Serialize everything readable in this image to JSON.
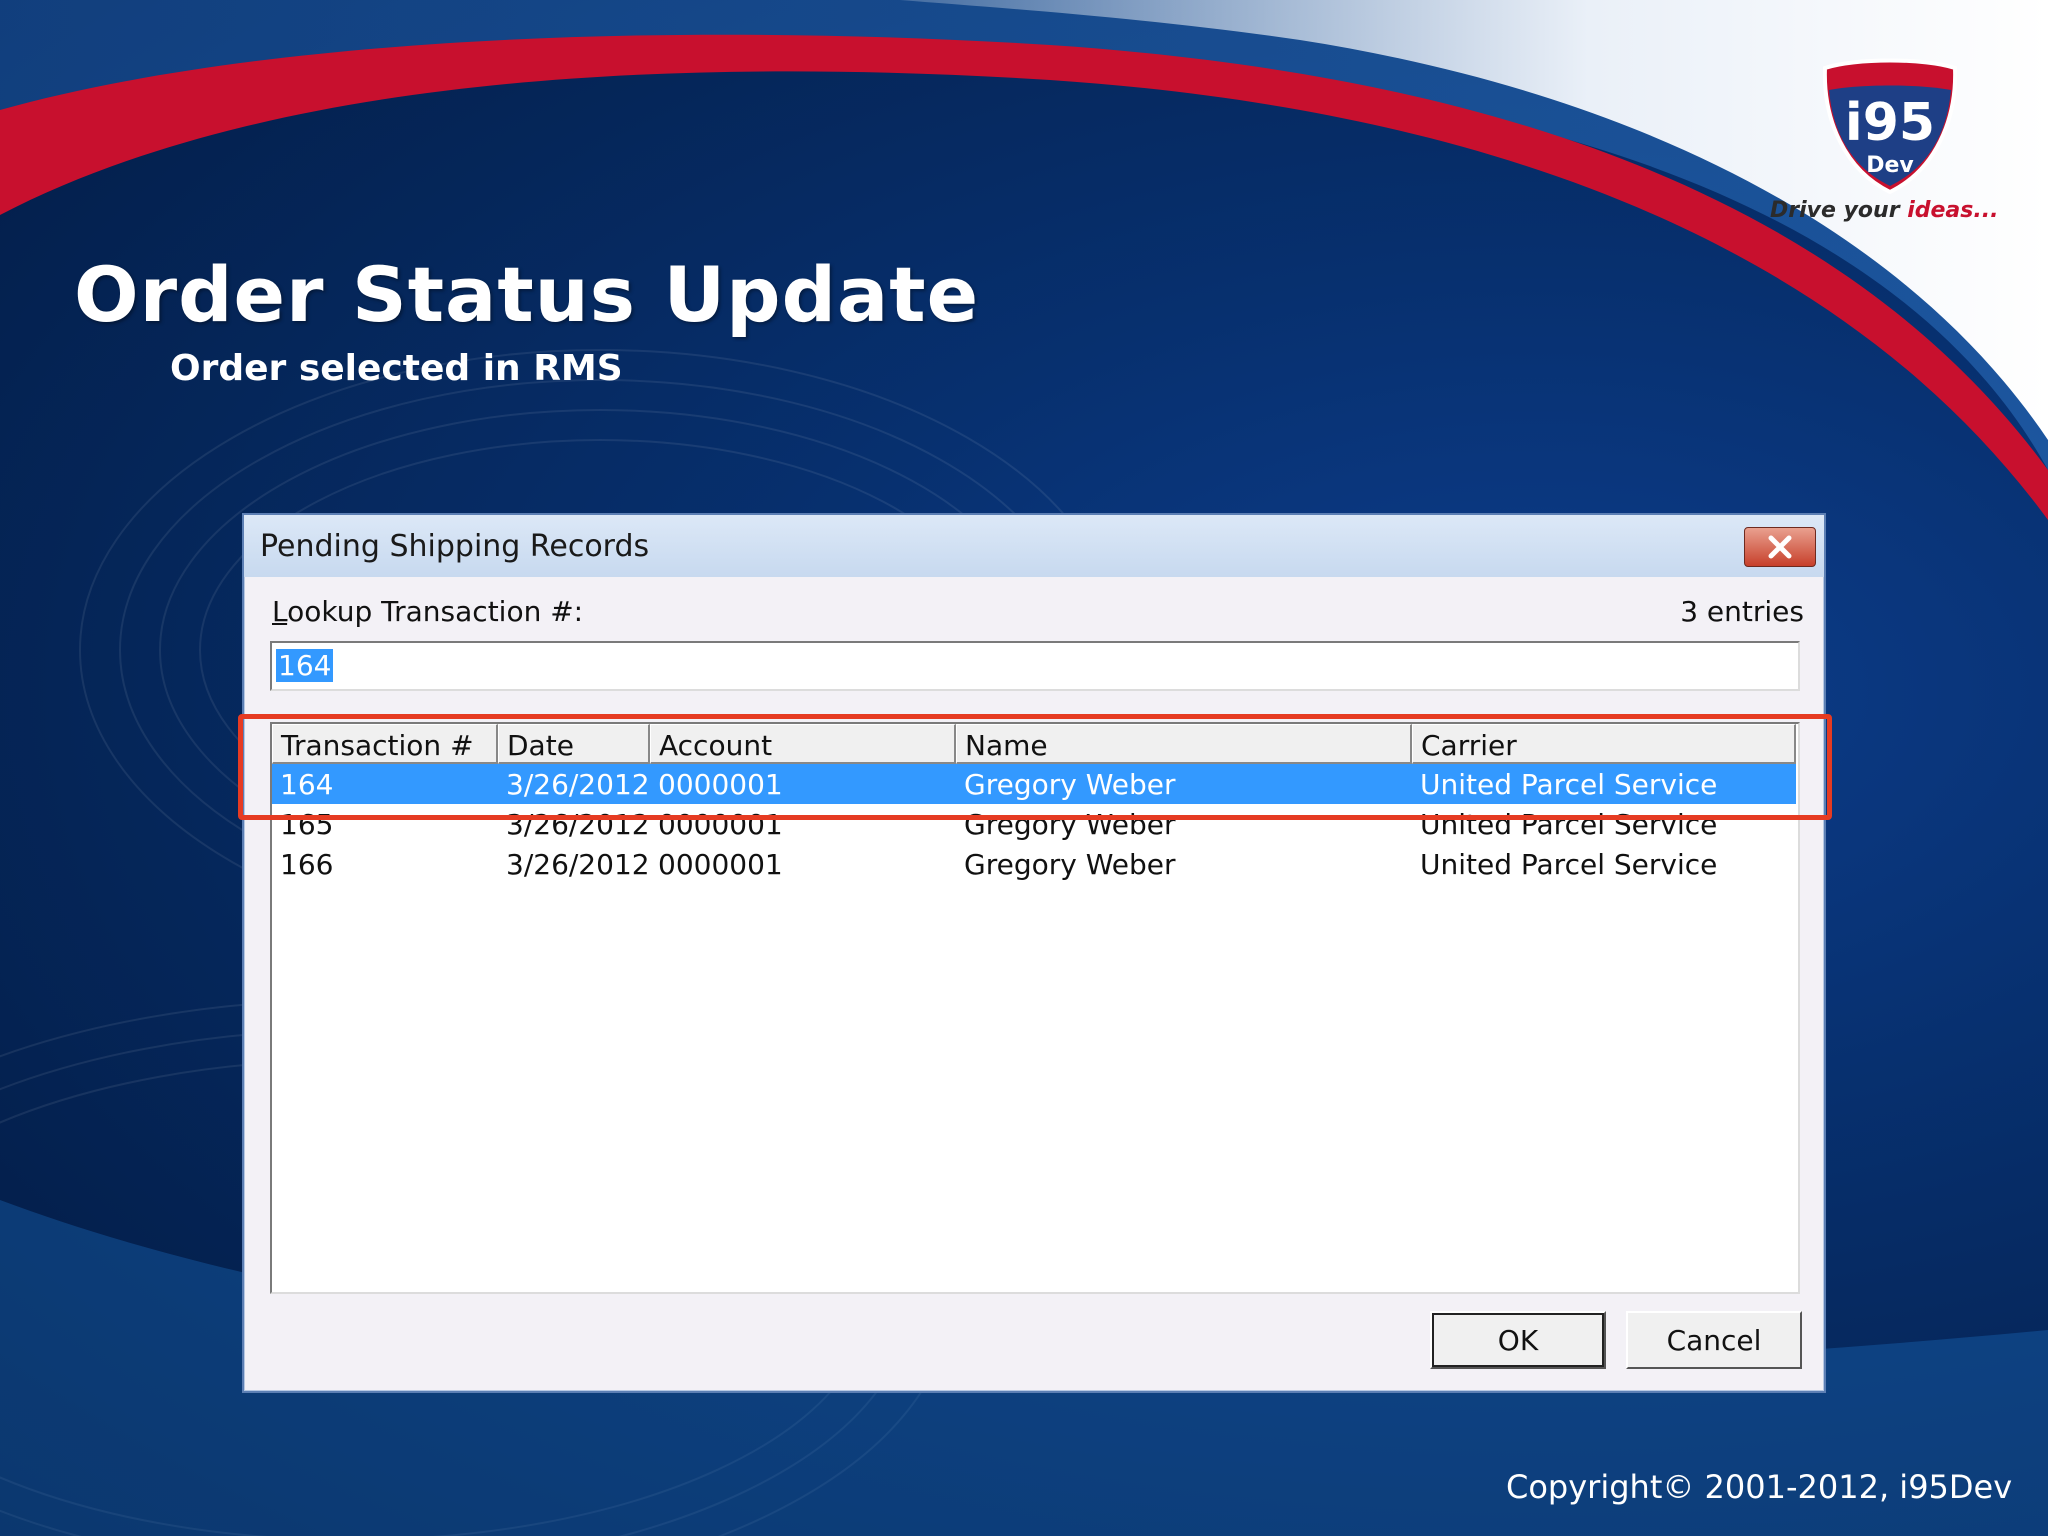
{
  "slide": {
    "title": "Order Status Update",
    "subtitle": "Order selected in RMS",
    "copyright": "Copyright©  2001-2012, i95Dev",
    "logo": {
      "brand": "i95",
      "sub": "Dev",
      "tagline_prefix": "Drive your ",
      "tagline_emphasis": "ideas..."
    }
  },
  "dialog": {
    "title": "Pending Shipping Records",
    "lookup_label_prefix": "L",
    "lookup_label_rest": "ookup Transaction #:",
    "entries": "3 entries",
    "lookup_value": "164",
    "columns": [
      "Transaction #",
      "Date",
      "Account",
      "Name",
      "Carrier"
    ],
    "rows": [
      [
        "164",
        "3/26/2012",
        "0000001",
        "Gregory Weber",
        "United Parcel Service"
      ],
      [
        "165",
        "3/26/2012",
        "0000001",
        "Gregory Weber",
        "United Parcel Service"
      ],
      [
        "166",
        "3/26/2012",
        "0000001",
        "Gregory Weber",
        "United Parcel Service"
      ]
    ],
    "selected_row": 0,
    "ok_label": "OK",
    "cancel_label": "Cancel"
  },
  "colors": {
    "selection": "#3399ff",
    "highlight_box": "#e63b22",
    "background_blue": "#07306f",
    "swoosh_red": "#c8102e"
  }
}
